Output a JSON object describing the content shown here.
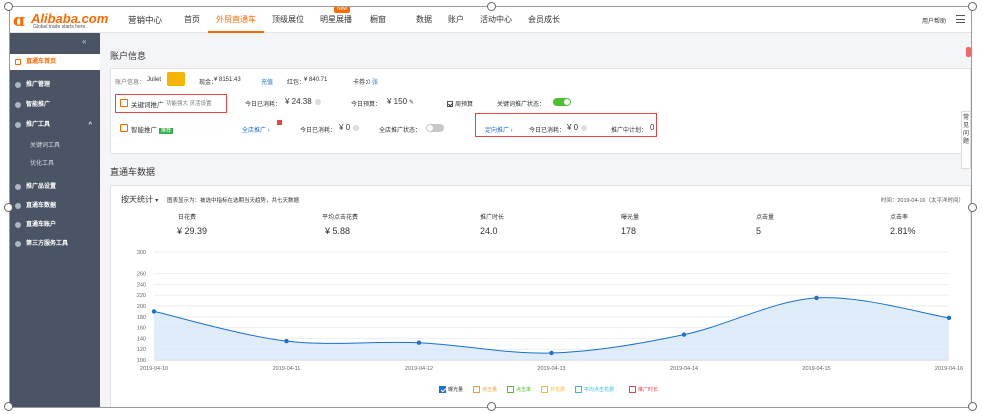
{
  "logo": {
    "word": "Alibaba.com",
    "tagline": "Global trade starts here."
  },
  "topnav": {
    "items": [
      {
        "label": "营销中心"
      },
      {
        "label": "首页"
      },
      {
        "label": "外贸直通车"
      },
      {
        "label": "顶级展位"
      },
      {
        "label": "明星展播"
      },
      {
        "label": "橱窗"
      },
      {
        "label": "数据"
      },
      {
        "label": "账户"
      },
      {
        "label": "活动中心"
      },
      {
        "label": "会员成长"
      }
    ],
    "new_badge": "New",
    "help": "用户帮助"
  },
  "sidebar": {
    "collapse": "«",
    "items": [
      {
        "label": "直通车首页"
      },
      {
        "label": "推广管理"
      },
      {
        "label": "智能推广"
      },
      {
        "label": "推广工具"
      },
      {
        "label": "关键词工具"
      },
      {
        "label": "优化工具"
      },
      {
        "label": "推广品设置"
      },
      {
        "label": "直通车数据"
      },
      {
        "label": "直通车账户"
      },
      {
        "label": "第三方服务工具"
      }
    ]
  },
  "account": {
    "section_title": "账户信息",
    "info_label": "账户信息：",
    "user": "Juliet",
    "balance_label": "现金：",
    "balance": "¥ 8151.43",
    "recharge": "充值",
    "redpacket_label": "红包：",
    "redpacket": "¥ 840.71",
    "coupon_label": "卡券：",
    "coupon": "0 张",
    "keyword": {
      "title": "关键词推广",
      "subtitle": "功能强大 灵活设置",
      "spent_label": "今日已消耗：",
      "spent": "¥ 24.38",
      "budget_label": "今日预算：",
      "budget": "¥ 150",
      "budget_check": "周预算",
      "status_label": "关键词推广状态："
    },
    "smart": {
      "title": "智能推广",
      "tag": "推荐",
      "all_store": "全店推广 ›",
      "spent_label": "今日已消耗：",
      "spent": "¥ 0",
      "status_label": "全店推广状态：",
      "directed": "定向推广 ›",
      "directed_spent_label": "今日已消耗：",
      "directed_spent": "¥ 0",
      "plans_label": "推广中计划：",
      "plans": "0"
    }
  },
  "data_section": {
    "title": "直通车数据",
    "period": "按天统计",
    "note": "图表显示为：被选中指标在选期当天趋势，共七天数据",
    "timestamp": "时间：2019-04-16（太平洋时间）",
    "stats": [
      {
        "label": "日花费",
        "value": "¥ 29.39"
      },
      {
        "label": "平均点击花费",
        "value": "¥ 5.88"
      },
      {
        "label": "推广时长",
        "value": "24.0"
      },
      {
        "label": "曝光量",
        "value": "178"
      },
      {
        "label": "点击量",
        "value": "5"
      },
      {
        "label": "点击率",
        "value": "2.81%"
      }
    ],
    "legend": [
      {
        "label": "曝光量",
        "color": "#1a6fd1",
        "checked": true
      },
      {
        "label": "点击量",
        "color": "#f0a030",
        "checked": false
      },
      {
        "label": "点击率",
        "color": "#4fbf2f",
        "checked": false
      },
      {
        "label": "日花费",
        "color": "#f0c030",
        "checked": false
      },
      {
        "label": "平均点击花费",
        "color": "#30c0d0",
        "checked": false
      },
      {
        "label": "推广时长",
        "color": "#e64545",
        "checked": false
      }
    ]
  },
  "chart_data": {
    "type": "area",
    "x": [
      "2019-04-10",
      "2019-04-11",
      "2019-04-12",
      "2019-04-13",
      "2019-04-14",
      "2019-04-15",
      "2019-04-16"
    ],
    "series": [
      {
        "name": "曝光量",
        "values": [
          190,
          135,
          132,
          113,
          147,
          215,
          178
        ]
      }
    ],
    "yticks": [
      100,
      120,
      140,
      160,
      180,
      200,
      220,
      240,
      260,
      300
    ],
    "ylim": [
      100,
      300
    ],
    "color": "#1a6fd1",
    "fill": "#d6e8f8"
  },
  "side_help": {
    "label": "常见问题"
  }
}
